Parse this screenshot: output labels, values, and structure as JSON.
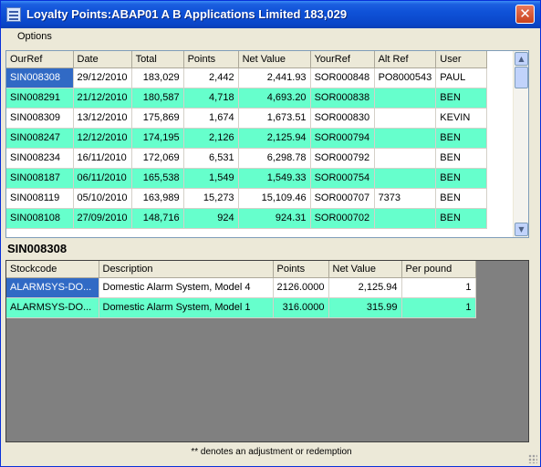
{
  "window": {
    "title": "Loyalty Points:ABAP01 A B Applications Limited 183,029",
    "close_label": "✕"
  },
  "menu": {
    "options_label": "Options"
  },
  "top_grid": {
    "headers": [
      "OurRef",
      "Date",
      "Total",
      "Points",
      "Net Value",
      "YourRef",
      "Alt Ref",
      "User"
    ],
    "rows": [
      [
        "SIN008308",
        "29/12/2010",
        "183,029",
        "2,442",
        "2,441.93",
        "SOR000848",
        "PO8000543",
        "PAUL"
      ],
      [
        "SIN008291",
        "21/12/2010",
        "180,587",
        "4,718",
        "4,693.20",
        "SOR000838",
        "",
        "BEN"
      ],
      [
        "SIN008309",
        "13/12/2010",
        "175,869",
        "1,674",
        "1,673.51",
        "SOR000830",
        "",
        "KEVIN"
      ],
      [
        "SIN008247",
        "12/12/2010",
        "174,195",
        "2,126",
        "2,125.94",
        "SOR000794",
        "",
        "BEN"
      ],
      [
        "SIN008234",
        "16/11/2010",
        "172,069",
        "6,531",
        "6,298.78",
        "SOR000792",
        "",
        "BEN"
      ],
      [
        "SIN008187",
        "06/11/2010",
        "165,538",
        "1,549",
        "1,549.33",
        "SOR000754",
        "",
        "BEN"
      ],
      [
        "SIN008119",
        "05/10/2010",
        "163,989",
        "15,273",
        "15,109.46",
        "SOR000707",
        "7373",
        "BEN"
      ],
      [
        "SIN008108",
        "27/09/2010",
        "148,716",
        "924",
        "924.31",
        "SOR000702",
        "",
        "BEN"
      ]
    ]
  },
  "detail": {
    "title": "SIN008308",
    "headers": [
      "Stockcode",
      "Description",
      "Points",
      "Net Value",
      "Per pound"
    ],
    "rows": [
      [
        "ALARMSYS-DO...",
        "Domestic Alarm System, Model 4",
        "2126.0000",
        "2,125.94",
        "1"
      ],
      [
        "ALARMSYS-DO...",
        "Domestic Alarm System, Model 1",
        "316.0000",
        "315.99",
        "1"
      ]
    ]
  },
  "footer": {
    "note": "** denotes an adjustment or redemption"
  }
}
